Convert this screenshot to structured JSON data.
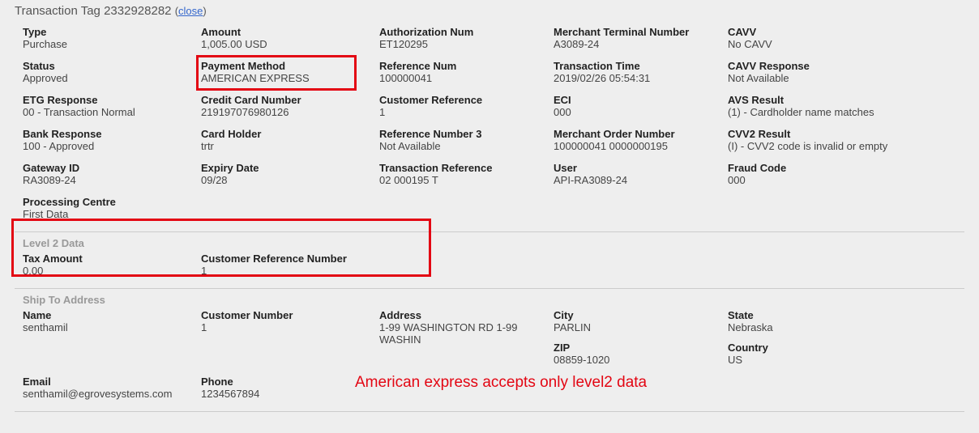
{
  "header": {
    "title_prefix": "Transaction Tag",
    "tag_id": "2332928282",
    "close_label": "close"
  },
  "main": {
    "type": {
      "label": "Type",
      "value": "Purchase"
    },
    "amount": {
      "label": "Amount",
      "value": "1,005.00 USD"
    },
    "auth_num": {
      "label": "Authorization Num",
      "value": "ET120295"
    },
    "merchant_terminal": {
      "label": "Merchant Terminal Number",
      "value": "A3089-24"
    },
    "cavv": {
      "label": "CAVV",
      "value": "No CAVV"
    },
    "status": {
      "label": "Status",
      "value": "Approved"
    },
    "payment_method": {
      "label": "Payment Method",
      "value": "AMERICAN EXPRESS"
    },
    "reference_num": {
      "label": "Reference Num",
      "value": "100000041"
    },
    "transaction_time": {
      "label": "Transaction Time",
      "value": "2019/02/26 05:54:31"
    },
    "cavv_response": {
      "label": "CAVV Response",
      "value": "Not Available"
    },
    "etg_response": {
      "label": "ETG Response",
      "value": "00 - Transaction Normal"
    },
    "cc_number": {
      "label": "Credit Card Number",
      "value": "219197076980126"
    },
    "customer_reference": {
      "label": "Customer Reference",
      "value": "1"
    },
    "eci": {
      "label": "ECI",
      "value": "000"
    },
    "avs_result": {
      "label": "AVS Result",
      "value": "(1) - Cardholder name matches"
    },
    "bank_response": {
      "label": "Bank Response",
      "value": "100 - Approved"
    },
    "card_holder": {
      "label": "Card Holder",
      "value": "trtr"
    },
    "ref_num3": {
      "label": "Reference Number 3",
      "value": "Not Available"
    },
    "merchant_order": {
      "label": "Merchant Order Number",
      "value": "100000041 0000000195"
    },
    "cvv2_result": {
      "label": "CVV2 Result",
      "value": "(I) - CVV2 code is invalid or empty"
    },
    "gateway_id": {
      "label": "Gateway ID",
      "value": "RA3089-24"
    },
    "expiry_date": {
      "label": "Expiry Date",
      "value": "09/28"
    },
    "trans_ref": {
      "label": "Transaction Reference",
      "value": "02 000195 T"
    },
    "user": {
      "label": "User",
      "value": "API-RA3089-24"
    },
    "fraud_code": {
      "label": "Fraud Code",
      "value": "000"
    },
    "processing_centre": {
      "label": "Processing Centre",
      "value": "First Data"
    }
  },
  "level2": {
    "section_title": "Level 2 Data",
    "tax_amount": {
      "label": "Tax Amount",
      "value": "0.00"
    },
    "cust_ref_num": {
      "label": "Customer Reference Number",
      "value": "1"
    }
  },
  "ship": {
    "section_title": "Ship To Address",
    "name": {
      "label": "Name",
      "value": "senthamil"
    },
    "customer_number": {
      "label": "Customer Number",
      "value": "1"
    },
    "address": {
      "label": "Address",
      "value": "1-99 WASHINGTON RD 1-99 WASHIN"
    },
    "city": {
      "label": "City",
      "value": "PARLIN"
    },
    "state": {
      "label": "State",
      "value": "Nebraska"
    },
    "zip": {
      "label": "ZIP",
      "value": "08859-1020"
    },
    "country": {
      "label": "Country",
      "value": "US"
    },
    "email": {
      "label": "Email",
      "value": "senthamil@egrovesystems.com"
    },
    "phone": {
      "label": "Phone",
      "value": "1234567894"
    }
  },
  "annotation": {
    "note": "American express accepts only level2 data"
  }
}
